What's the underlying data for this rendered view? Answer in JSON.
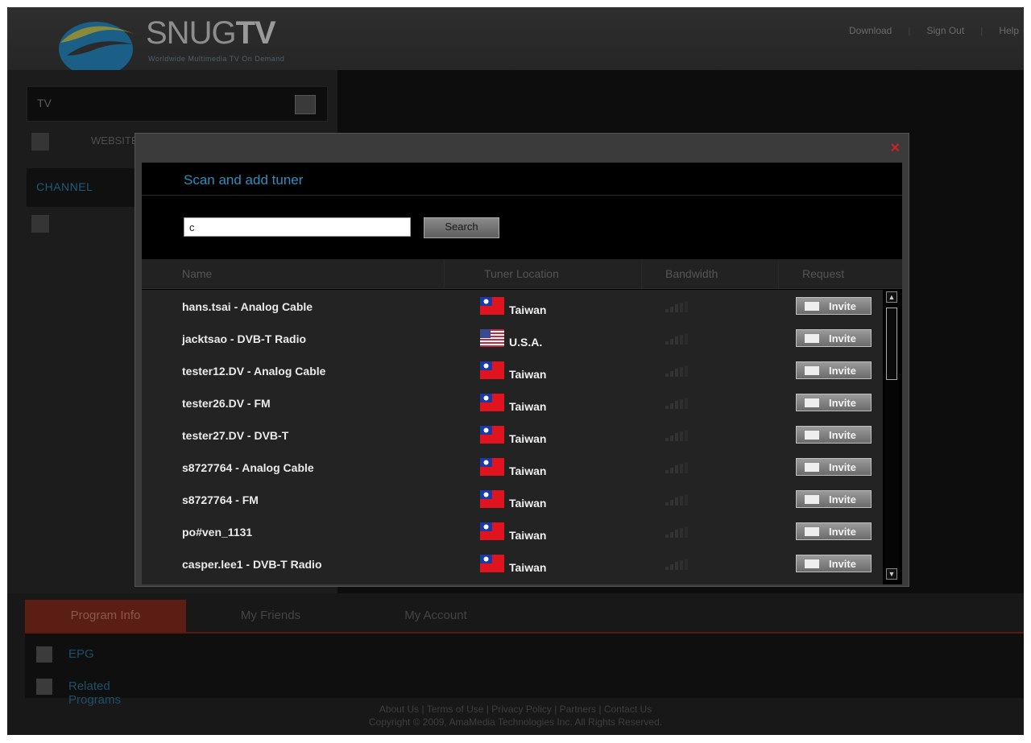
{
  "header": {
    "brand_light": "SNUG",
    "brand_bold": "TV",
    "tagline": "Worldwide Multimedia TV On Demand",
    "nav": [
      "Download",
      "Sign Out",
      "Help"
    ]
  },
  "sidebar": {
    "search_value": "TV",
    "row1_label": "WEBSITE",
    "channel_label": "CHANNEL"
  },
  "modal": {
    "title": "Scan and add tuner",
    "search_value": "c",
    "search_button": "Search",
    "columns": [
      "Name",
      "Tuner Location",
      "Bandwidth",
      "Request"
    ],
    "rows": [
      {
        "name": "hans.tsai - Analog Cable",
        "location": "Taiwan",
        "flag": "taiwan",
        "request": "Invite"
      },
      {
        "name": "jacktsao - DVB-T Radio",
        "location": "U.S.A.",
        "flag": "usa",
        "request": "Invite"
      },
      {
        "name": "tester12.DV - Analog Cable",
        "location": "Taiwan",
        "flag": "taiwan",
        "request": "Invite"
      },
      {
        "name": "tester26.DV - FM",
        "location": "Taiwan",
        "flag": "taiwan",
        "request": "Invite"
      },
      {
        "name": "tester27.DV - DVB-T",
        "location": "Taiwan",
        "flag": "taiwan",
        "request": "Invite"
      },
      {
        "name": "s8727764 - Analog Cable",
        "location": "Taiwan",
        "flag": "taiwan",
        "request": "Invite"
      },
      {
        "name": "s8727764 - FM",
        "location": "Taiwan",
        "flag": "taiwan",
        "request": "Invite"
      },
      {
        "name": "po#ven_1131",
        "location": "Taiwan",
        "flag": "taiwan",
        "request": "Invite"
      },
      {
        "name": "casper.lee1 - DVB-T Radio",
        "location": "Taiwan",
        "flag": "taiwan",
        "request": "Invite"
      }
    ]
  },
  "tabs": [
    "Program Info",
    "My Friends",
    "My Account"
  ],
  "lower": [
    "EPG",
    "Related Programs"
  ],
  "footer": {
    "links": "About Us | Terms of Use | Privacy Policy | Partners | Contact Us",
    "copyright": "Copyright © 2009, AmaMedia Technologies Inc. All Rights Reserved."
  },
  "colors": {
    "accent_blue": "#2e8fbd",
    "close_red": "#cc2222",
    "tab_active": "#5a1e14"
  },
  "icons": {
    "close": "close-icon",
    "invite": "envelope-icon",
    "scroll_up": "arrow-up-icon",
    "scroll_down": "arrow-down-icon"
  }
}
